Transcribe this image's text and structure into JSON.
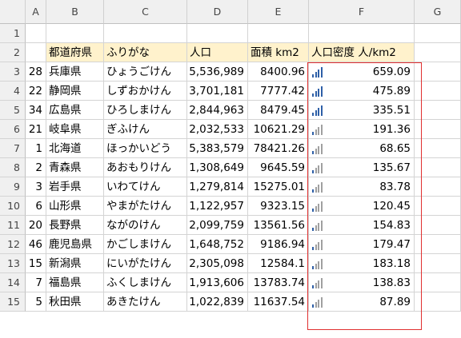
{
  "columns": [
    "A",
    "B",
    "C",
    "D",
    "E",
    "F",
    "G"
  ],
  "row_numbers": [
    "1",
    "2",
    "3",
    "4",
    "5",
    "6",
    "7",
    "8",
    "9",
    "10",
    "11",
    "12",
    "13",
    "14",
    "15"
  ],
  "header": {
    "prefecture": "都道府県",
    "furigana": "ふりがな",
    "population": "人口",
    "area": "面積 km2",
    "density": "人口密度 人/km2"
  },
  "colors": {
    "header_fill": "#fff2cc",
    "bar_active": "#2e5fa7",
    "bar_inactive": "#a0a0a0",
    "highlight_box": "#e03030"
  },
  "rows": [
    {
      "code": "28",
      "name": "兵庫県",
      "kana": "ひょうごけん",
      "population": "5,536,989",
      "area": "8400.96",
      "density": "659.09",
      "signal_level": 4
    },
    {
      "code": "22",
      "name": "静岡県",
      "kana": "しずおかけん",
      "population": "3,701,181",
      "area": "7777.42",
      "density": "475.89",
      "signal_level": 4
    },
    {
      "code": "34",
      "name": "広島県",
      "kana": "ひろしまけん",
      "population": "2,844,963",
      "area": "8479.45",
      "density": "335.51",
      "signal_level": 4
    },
    {
      "code": "21",
      "name": "岐阜県",
      "kana": "ぎふけん",
      "population": "2,032,533",
      "area": "10621.29",
      "density": "191.36",
      "signal_level": 1
    },
    {
      "code": "1",
      "name": "北海道",
      "kana": "ほっかいどう",
      "population": "5,383,579",
      "area": "78421.26",
      "density": "68.65",
      "signal_level": 1
    },
    {
      "code": "2",
      "name": "青森県",
      "kana": "あおもりけん",
      "population": "1,308,649",
      "area": "9645.59",
      "density": "135.67",
      "signal_level": 1
    },
    {
      "code": "3",
      "name": "岩手県",
      "kana": "いわてけん",
      "population": "1,279,814",
      "area": "15275.01",
      "density": "83.78",
      "signal_level": 1
    },
    {
      "code": "6",
      "name": "山形県",
      "kana": "やまがたけん",
      "population": "1,122,957",
      "area": "9323.15",
      "density": "120.45",
      "signal_level": 1
    },
    {
      "code": "20",
      "name": "長野県",
      "kana": "ながのけん",
      "population": "2,099,759",
      "area": "13561.56",
      "density": "154.83",
      "signal_level": 1
    },
    {
      "code": "46",
      "name": "鹿児島県",
      "kana": "かごしまけん",
      "population": "1,648,752",
      "area": "9186.94",
      "density": "179.47",
      "signal_level": 1
    },
    {
      "code": "15",
      "name": "新潟県",
      "kana": "にいがたけん",
      "population": "2,305,098",
      "area": "12584.1",
      "density": "183.18",
      "signal_level": 1
    },
    {
      "code": "7",
      "name": "福島県",
      "kana": "ふくしまけん",
      "population": "1,913,606",
      "area": "13783.74",
      "density": "138.83",
      "signal_level": 1
    },
    {
      "code": "5",
      "name": "秋田県",
      "kana": "あきたけん",
      "population": "1,022,839",
      "area": "11637.54",
      "density": "87.89",
      "signal_level": 1
    }
  ]
}
